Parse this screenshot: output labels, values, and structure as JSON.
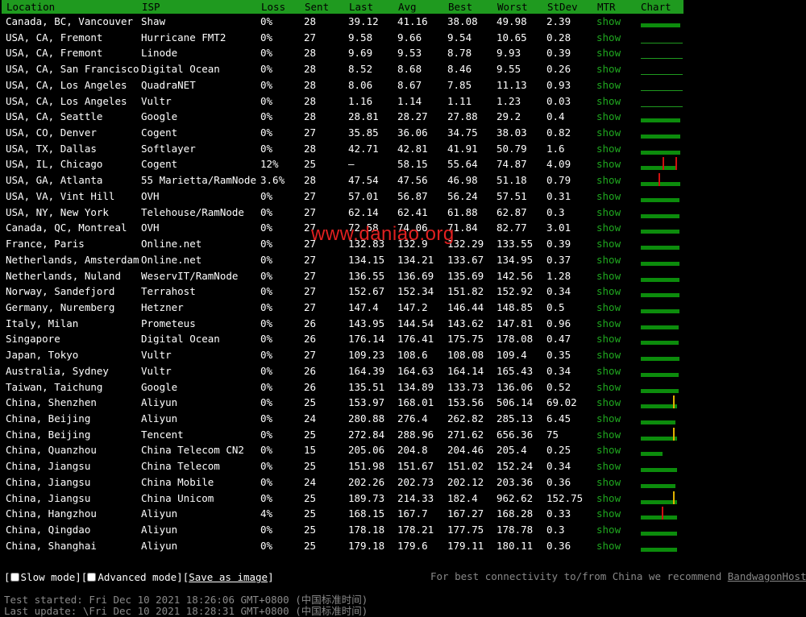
{
  "headers": [
    "Location",
    "ISP",
    "Loss",
    "Sent",
    "Last",
    "Avg",
    "Best",
    "Worst",
    "StDev",
    "MTR",
    "Chart"
  ],
  "rows": [
    {
      "location": "Canada, BC, Vancouver",
      "isp": "Shaw",
      "loss": "0%",
      "sent": "28",
      "last": "39.12",
      "avg": "41.16",
      "best": "38.08",
      "worst": "49.98",
      "stdev": "2.39",
      "mtr": "show",
      "chart": {
        "fill": 0.95,
        "spikes": []
      }
    },
    {
      "location": "USA, CA, Fremont",
      "isp": "Hurricane FMT2",
      "loss": "0%",
      "sent": "27",
      "last": "9.58",
      "avg": "9.66",
      "best": "9.54",
      "worst": "10.65",
      "stdev": "0.28",
      "mtr": "show",
      "chart": {
        "fill": 0,
        "spikes": []
      }
    },
    {
      "location": "USA, CA, Fremont",
      "isp": "Linode",
      "loss": "0%",
      "sent": "28",
      "last": "9.69",
      "avg": "9.53",
      "best": "8.78",
      "worst": "9.93",
      "stdev": "0.39",
      "mtr": "show",
      "chart": {
        "fill": 0,
        "spikes": []
      }
    },
    {
      "location": "USA, CA, San Francisco",
      "isp": "Digital Ocean",
      "loss": "0%",
      "sent": "28",
      "last": "8.52",
      "avg": "8.68",
      "best": "8.46",
      "worst": "9.55",
      "stdev": "0.26",
      "mtr": "show",
      "chart": {
        "fill": 0,
        "spikes": []
      }
    },
    {
      "location": "USA, CA, Los Angeles",
      "isp": "QuadraNET",
      "loss": "0%",
      "sent": "28",
      "last": "8.06",
      "avg": "8.67",
      "best": "7.85",
      "worst": "11.13",
      "stdev": "0.93",
      "mtr": "show",
      "chart": {
        "fill": 0,
        "spikes": []
      }
    },
    {
      "location": "USA, CA, Los Angeles",
      "isp": "Vultr",
      "loss": "0%",
      "sent": "28",
      "last": "1.16",
      "avg": "1.14",
      "best": "1.11",
      "worst": "1.23",
      "stdev": "0.03",
      "mtr": "show",
      "chart": {
        "fill": 0,
        "spikes": []
      }
    },
    {
      "location": "USA, CA, Seattle",
      "isp": "Google",
      "loss": "0%",
      "sent": "28",
      "last": "28.81",
      "avg": "28.27",
      "best": "27.88",
      "worst": "29.2",
      "stdev": "0.4",
      "mtr": "show",
      "chart": {
        "fill": 0.95,
        "spikes": []
      }
    },
    {
      "location": "USA, CO, Denver",
      "isp": "Cogent",
      "loss": "0%",
      "sent": "27",
      "last": "35.85",
      "avg": "36.06",
      "best": "34.75",
      "worst": "38.03",
      "stdev": "0.82",
      "mtr": "show",
      "chart": {
        "fill": 0.95,
        "spikes": []
      }
    },
    {
      "location": "USA, TX, Dallas",
      "isp": "Softlayer",
      "loss": "0%",
      "sent": "28",
      "last": "42.71",
      "avg": "42.81",
      "best": "41.91",
      "worst": "50.79",
      "stdev": "1.6",
      "mtr": "show",
      "chart": {
        "fill": 0.95,
        "spikes": []
      }
    },
    {
      "location": "USA, IL, Chicago",
      "isp": "Cogent",
      "loss": "12%",
      "sent": "25",
      "last": "–",
      "avg": "58.15",
      "best": "55.64",
      "worst": "74.87",
      "stdev": "4.09",
      "mtr": "show",
      "chart": {
        "fill": 0.85,
        "spikes": [
          {
            "pos": 0.52,
            "color": "#d01010"
          },
          {
            "pos": 0.82,
            "color": "#d01010"
          }
        ]
      }
    },
    {
      "location": "USA, GA, Atlanta",
      "isp": "55 Marietta/RamNode",
      "loss": "3.6%",
      "sent": "28",
      "last": "47.54",
      "avg": "47.56",
      "best": "46.98",
      "worst": "51.18",
      "stdev": "0.79",
      "mtr": "show",
      "chart": {
        "fill": 0.95,
        "spikes": [
          {
            "pos": 0.42,
            "color": "#d01010"
          }
        ]
      }
    },
    {
      "location": "USA, VA, Vint Hill",
      "isp": "OVH",
      "loss": "0%",
      "sent": "27",
      "last": "57.01",
      "avg": "56.87",
      "best": "56.24",
      "worst": "57.51",
      "stdev": "0.31",
      "mtr": "show",
      "chart": {
        "fill": 0.93,
        "spikes": []
      }
    },
    {
      "location": "USA, NY, New York",
      "isp": "Telehouse/RamNode",
      "loss": "0%",
      "sent": "27",
      "last": "62.14",
      "avg": "62.41",
      "best": "61.88",
      "worst": "62.87",
      "stdev": "0.3",
      "mtr": "show",
      "chart": {
        "fill": 0.93,
        "spikes": []
      }
    },
    {
      "location": "Canada, QC, Montreal",
      "isp": "OVH",
      "loss": "0%",
      "sent": "27",
      "last": "72.58",
      "avg": "74.06",
      "best": "71.84",
      "worst": "82.77",
      "stdev": "3.01",
      "mtr": "show",
      "chart": {
        "fill": 0.93,
        "spikes": []
      }
    },
    {
      "location": "France, Paris",
      "isp": "Online.net",
      "loss": "0%",
      "sent": "27",
      "last": "132.83",
      "avg": "132.9",
      "best": "132.29",
      "worst": "133.55",
      "stdev": "0.39",
      "mtr": "show",
      "chart": {
        "fill": 0.93,
        "spikes": []
      }
    },
    {
      "location": "Netherlands, Amsterdam",
      "isp": "Online.net",
      "loss": "0%",
      "sent": "27",
      "last": "134.15",
      "avg": "134.21",
      "best": "133.67",
      "worst": "134.95",
      "stdev": "0.37",
      "mtr": "show",
      "chart": {
        "fill": 0.93,
        "spikes": []
      }
    },
    {
      "location": "Netherlands, Nuland",
      "isp": "WeservIT/RamNode",
      "loss": "0%",
      "sent": "27",
      "last": "136.55",
      "avg": "136.69",
      "best": "135.69",
      "worst": "142.56",
      "stdev": "1.28",
      "mtr": "show",
      "chart": {
        "fill": 0.93,
        "spikes": []
      }
    },
    {
      "location": "Norway, Sandefjord",
      "isp": "Terrahost",
      "loss": "0%",
      "sent": "27",
      "last": "152.67",
      "avg": "152.34",
      "best": "151.82",
      "worst": "152.92",
      "stdev": "0.34",
      "mtr": "show",
      "chart": {
        "fill": 0.93,
        "spikes": []
      }
    },
    {
      "location": "Germany, Nuremberg",
      "isp": "Hetzner",
      "loss": "0%",
      "sent": "27",
      "last": "147.4",
      "avg": "147.2",
      "best": "146.44",
      "worst": "148.85",
      "stdev": "0.5",
      "mtr": "show",
      "chart": {
        "fill": 0.93,
        "spikes": []
      }
    },
    {
      "location": "Italy, Milan",
      "isp": "Prometeus",
      "loss": "0%",
      "sent": "26",
      "last": "143.95",
      "avg": "144.54",
      "best": "143.62",
      "worst": "147.81",
      "stdev": "0.96",
      "mtr": "show",
      "chart": {
        "fill": 0.9,
        "spikes": []
      }
    },
    {
      "location": "Singapore",
      "isp": "Digital Ocean",
      "loss": "0%",
      "sent": "26",
      "last": "176.14",
      "avg": "176.41",
      "best": "175.75",
      "worst": "178.08",
      "stdev": "0.47",
      "mtr": "show",
      "chart": {
        "fill": 0.9,
        "spikes": []
      }
    },
    {
      "location": "Japan, Tokyo",
      "isp": "Vultr",
      "loss": "0%",
      "sent": "27",
      "last": "109.23",
      "avg": "108.6",
      "best": "108.08",
      "worst": "109.4",
      "stdev": "0.35",
      "mtr": "show",
      "chart": {
        "fill": 0.93,
        "spikes": []
      }
    },
    {
      "location": "Australia, Sydney",
      "isp": "Vultr",
      "loss": "0%",
      "sent": "26",
      "last": "164.39",
      "avg": "164.63",
      "best": "164.14",
      "worst": "165.43",
      "stdev": "0.34",
      "mtr": "show",
      "chart": {
        "fill": 0.9,
        "spikes": []
      }
    },
    {
      "location": "Taiwan, Taichung",
      "isp": "Google",
      "loss": "0%",
      "sent": "26",
      "last": "135.51",
      "avg": "134.89",
      "best": "133.73",
      "worst": "136.06",
      "stdev": "0.52",
      "mtr": "show",
      "chart": {
        "fill": 0.9,
        "spikes": []
      }
    },
    {
      "location": "China, Shenzhen",
      "isp": "Aliyun",
      "loss": "0%",
      "sent": "25",
      "last": "153.97",
      "avg": "168.01",
      "best": "153.56",
      "worst": "506.14",
      "stdev": "69.02",
      "mtr": "show",
      "chart": {
        "fill": 0.86,
        "spikes": [
          {
            "pos": 0.76,
            "color": "#e0b000"
          }
        ]
      }
    },
    {
      "location": "China, Beijing",
      "isp": "Aliyun",
      "loss": "0%",
      "sent": "24",
      "last": "280.88",
      "avg": "276.4",
      "best": "262.82",
      "worst": "285.13",
      "stdev": "6.45",
      "mtr": "show",
      "chart": {
        "fill": 0.82,
        "spikes": []
      }
    },
    {
      "location": "China, Beijing",
      "isp": "Tencent",
      "loss": "0%",
      "sent": "25",
      "last": "272.84",
      "avg": "288.96",
      "best": "271.62",
      "worst": "656.36",
      "stdev": "75",
      "mtr": "show",
      "chart": {
        "fill": 0.86,
        "spikes": [
          {
            "pos": 0.76,
            "color": "#e0b000"
          }
        ]
      }
    },
    {
      "location": "China, Quanzhou",
      "isp": "China Telecom CN2",
      "loss": "0%",
      "sent": "15",
      "last": "205.06",
      "avg": "204.8",
      "best": "204.46",
      "worst": "205.4",
      "stdev": "0.25",
      "mtr": "show",
      "chart": {
        "fill": 0.52,
        "spikes": []
      }
    },
    {
      "location": "China, Jiangsu",
      "isp": "China Telecom",
      "loss": "0%",
      "sent": "25",
      "last": "151.98",
      "avg": "151.67",
      "best": "151.02",
      "worst": "152.24",
      "stdev": "0.34",
      "mtr": "show",
      "chart": {
        "fill": 0.86,
        "spikes": []
      }
    },
    {
      "location": "China, Jiangsu",
      "isp": "China Mobile",
      "loss": "0%",
      "sent": "24",
      "last": "202.26",
      "avg": "202.73",
      "best": "202.12",
      "worst": "203.36",
      "stdev": "0.36",
      "mtr": "show",
      "chart": {
        "fill": 0.82,
        "spikes": []
      }
    },
    {
      "location": "China, Jiangsu",
      "isp": "China Unicom",
      "loss": "0%",
      "sent": "25",
      "last": "189.73",
      "avg": "214.33",
      "best": "182.4",
      "worst": "962.62",
      "stdev": "152.75",
      "mtr": "show",
      "chart": {
        "fill": 0.86,
        "spikes": [
          {
            "pos": 0.76,
            "color": "#e0b000"
          }
        ]
      }
    },
    {
      "location": "China, Hangzhou",
      "isp": "Aliyun",
      "loss": "4%",
      "sent": "25",
      "last": "168.15",
      "avg": "167.7",
      "best": "167.27",
      "worst": "168.28",
      "stdev": "0.33",
      "mtr": "show",
      "chart": {
        "fill": 0.86,
        "spikes": [
          {
            "pos": 0.5,
            "color": "#d01010"
          }
        ]
      }
    },
    {
      "location": "China, Qingdao",
      "isp": "Aliyun",
      "loss": "0%",
      "sent": "25",
      "last": "178.18",
      "avg": "178.21",
      "best": "177.75",
      "worst": "178.78",
      "stdev": "0.3",
      "mtr": "show",
      "chart": {
        "fill": 0.86,
        "spikes": []
      }
    },
    {
      "location": "China, Shanghai",
      "isp": "Aliyun",
      "loss": "0%",
      "sent": "25",
      "last": "179.18",
      "avg": "179.6",
      "best": "179.11",
      "worst": "180.11",
      "stdev": "0.36",
      "mtr": "show",
      "chart": {
        "fill": 0.86,
        "spikes": []
      }
    }
  ],
  "watermark": "www.daniao.org",
  "footer": {
    "open1": "[",
    "slow_mode": "Slow mode",
    "mid": "][",
    "advanced_mode": "Advanced mode",
    "mid2": "][",
    "save_image": "Save as image",
    "close": "]",
    "recommend_text": "For best connectivity to/from China we recommend ",
    "recommend_link": "BandwagonHost",
    "recommend_end": "."
  },
  "test_started": "Test started: Fri Dec 10 2021 18:26:06 GMT+0800 (中国标准时间)",
  "last_update": "Last update: \\Fri Dec 10 2021 18:28:31 GMT+0800 (中国标准时间)",
  "colors": {
    "header": "#1f9a1f",
    "link": "#1fa81f",
    "bar": "#0c8c0c",
    "loss_spike": "#d01010",
    "jitter_spike": "#e0b000"
  }
}
